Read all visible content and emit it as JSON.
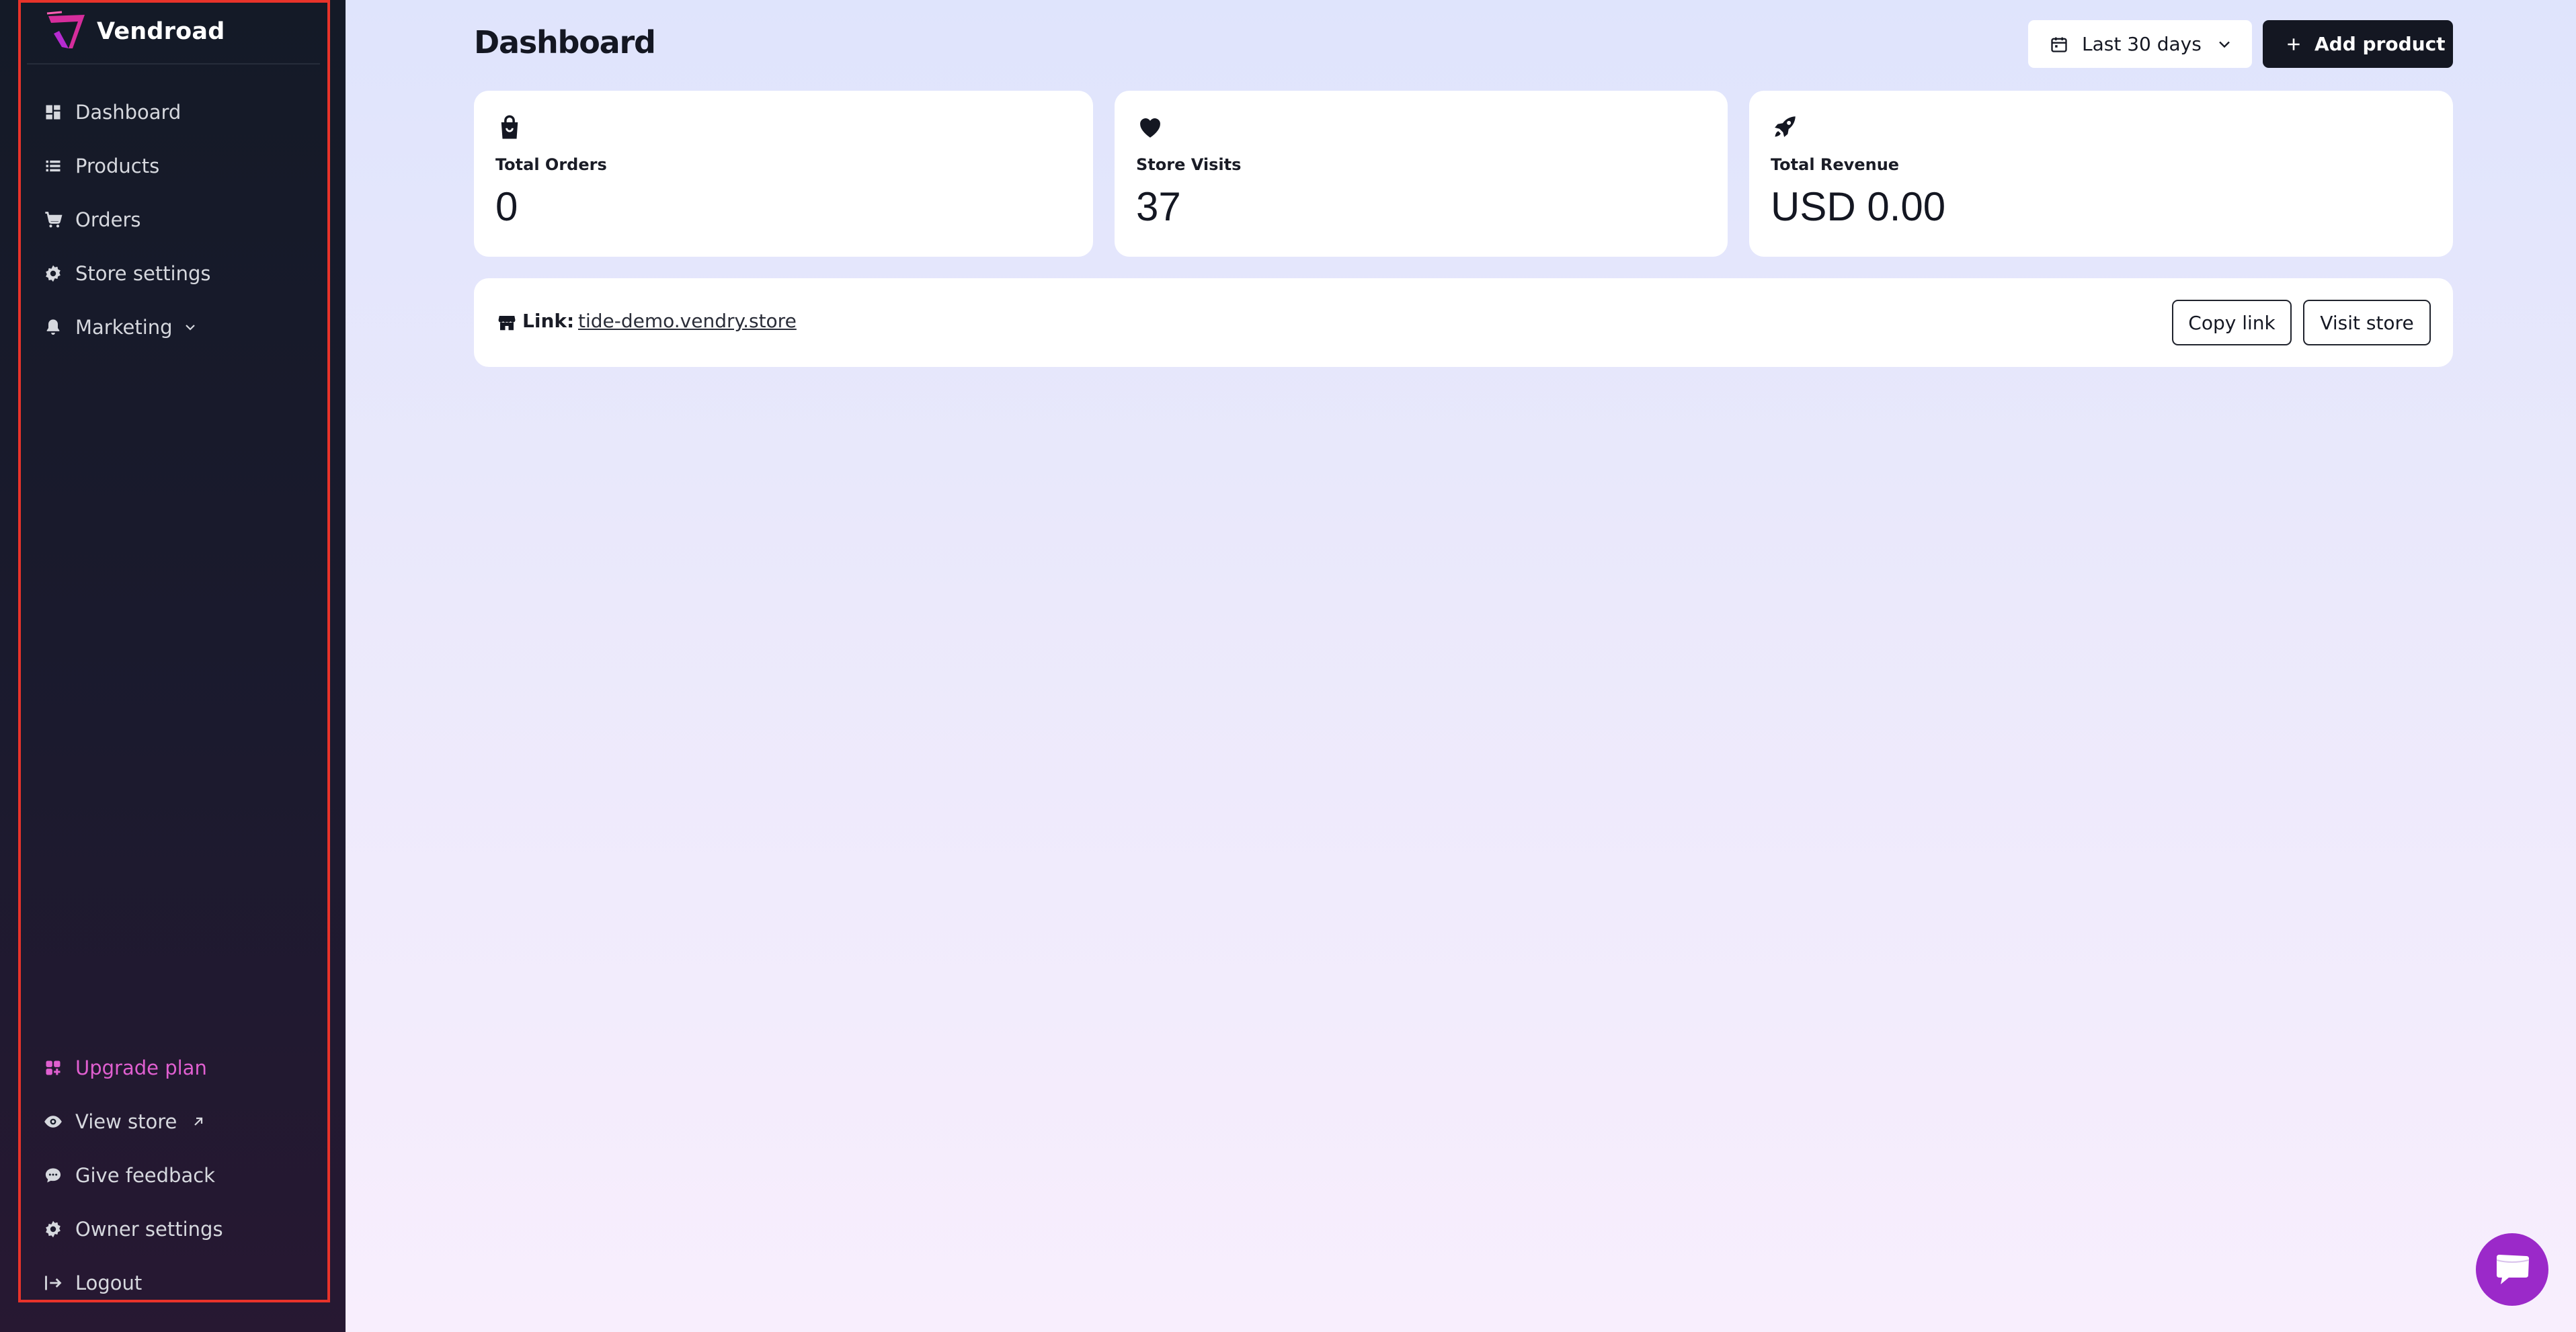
{
  "brand": {
    "name": "Vendroad",
    "accent": "#d62d9c"
  },
  "sidebar": {
    "items": [
      {
        "label": "Dashboard",
        "icon": "dashboard-icon"
      },
      {
        "label": "Products",
        "icon": "list-icon"
      },
      {
        "label": "Orders",
        "icon": "cart-icon"
      },
      {
        "label": "Store settings",
        "icon": "gear-icon"
      },
      {
        "label": "Marketing",
        "icon": "bell-icon",
        "expandable": true
      }
    ],
    "bottom": [
      {
        "label": "Upgrade plan",
        "icon": "apps-plus-icon",
        "color": "#e05fd0"
      },
      {
        "label": "View store",
        "icon": "eye-icon",
        "external": true
      },
      {
        "label": "Give feedback",
        "icon": "chat-icon"
      },
      {
        "label": "Owner settings",
        "icon": "gear-icon"
      },
      {
        "label": "Logout",
        "icon": "logout-icon"
      }
    ]
  },
  "header": {
    "title": "Dashboard",
    "date_range": "Last 30 days",
    "add_product": "Add product"
  },
  "stats": [
    {
      "label": "Total Orders",
      "value": "0",
      "icon": "shopping-bag-icon"
    },
    {
      "label": "Store Visits",
      "value": "37",
      "icon": "heart-icon"
    },
    {
      "label": "Total Revenue",
      "value": "USD 0.00",
      "icon": "rocket-icon"
    }
  ],
  "store_link": {
    "label": "Link:",
    "url": "tide-demo.vendry.store",
    "copy_label": "Copy link",
    "visit_label": "Visit store"
  },
  "colors": {
    "sidebar_bg": "#151a28",
    "primary_button": "#141722",
    "chat_button": "#9b29c9",
    "upgrade_text": "#e05fd0"
  }
}
